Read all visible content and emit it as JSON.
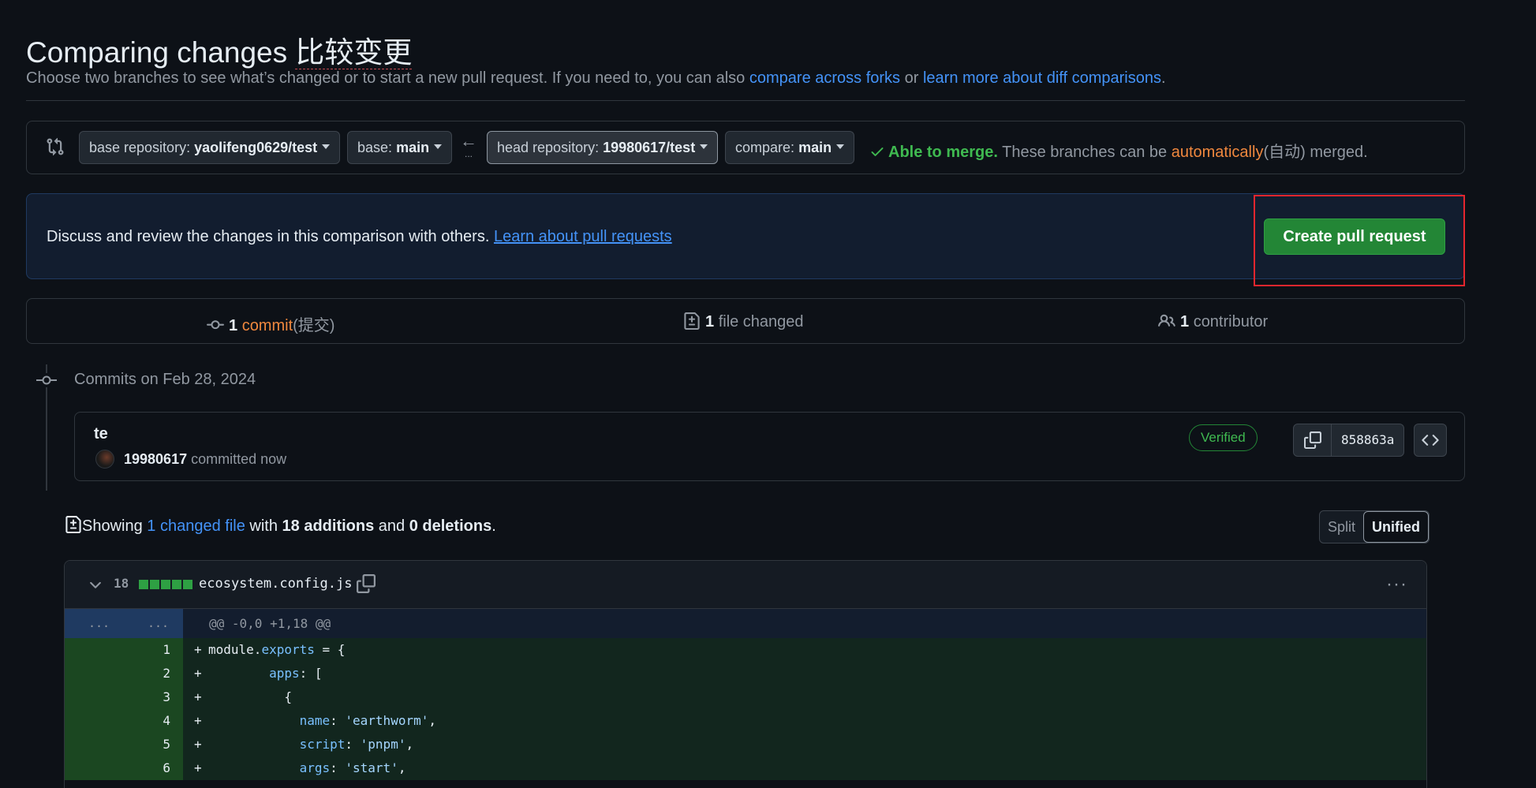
{
  "header": {
    "title": "Comparing changes",
    "title_cn": "比较变更",
    "subtitle_prefix": "Choose two branches to see what’s changed or to start a new pull request. If you need to, you can also",
    "link_forks": "compare across forks",
    "subtitle_or": "or",
    "link_diff": "learn more about diff comparisons",
    "subtitle_end": "."
  },
  "range": {
    "base_repo_label": "base repository:",
    "base_repo_value": "yaolifeng0629/test",
    "base_label": "base:",
    "base_value": "main",
    "arrow": "←",
    "arrow_dots": "...",
    "head_repo_label": "head repository:",
    "head_repo_value": "19980617/test",
    "compare_label": "compare:",
    "compare_value": "main",
    "merge_status": "Able to merge.",
    "merge_text": "These branches can be",
    "merge_auto": "automatically",
    "merge_auto_cn": "(自动)",
    "merge_end": "merged."
  },
  "banner": {
    "text": "Discuss and review the changes in this comparison with others.",
    "link": "Learn about pull requests",
    "button": "Create pull request"
  },
  "summary": {
    "commits_count": "1",
    "commits_label": "commit",
    "commits_cn": "(提交)",
    "files_count": "1",
    "files_label": "file changed",
    "contrib_count": "1",
    "contrib_label": "contributor"
  },
  "commits": {
    "date_heading": "Commits on Feb 28, 2024",
    "items": [
      {
        "title": "te",
        "author": "19980617",
        "meta": "committed now",
        "badge": "Verified",
        "sha": "858863a"
      }
    ]
  },
  "diff_toolbar": {
    "showing": "Showing",
    "changed_file": "1 changed file",
    "with": "with",
    "additions": "18 additions",
    "and": "and",
    "deletions": "0 deletions",
    "period": ".",
    "split": "Split",
    "unified": "Unified"
  },
  "file": {
    "count": "18",
    "name": "ecosystem.config.js",
    "kebab": "···",
    "hunk_left": "...",
    "hunk_right": "...",
    "hunk": "@@ -0,0 +1,18 @@",
    "lines": [
      {
        "n": "1",
        "indent": "",
        "parts": [
          [
            "",
            "module."
          ],
          [
            "prop",
            "exports"
          ],
          [
            "",
            " = {"
          ]
        ]
      },
      {
        "n": "2",
        "indent": "        ",
        "parts": [
          [
            "prop",
            "apps"
          ],
          [
            "",
            ": ["
          ]
        ]
      },
      {
        "n": "3",
        "indent": "          ",
        "parts": [
          [
            "",
            "{"
          ]
        ]
      },
      {
        "n": "4",
        "indent": "            ",
        "parts": [
          [
            "prop",
            "name"
          ],
          [
            "",
            ": "
          ],
          [
            "str",
            "'earthworm'"
          ],
          [
            "",
            ","
          ]
        ]
      },
      {
        "n": "5",
        "indent": "            ",
        "parts": [
          [
            "prop",
            "script"
          ],
          [
            "",
            ": "
          ],
          [
            "str",
            "'pnpm'"
          ],
          [
            "",
            ","
          ]
        ]
      },
      {
        "n": "6",
        "indent": "            ",
        "parts": [
          [
            "prop",
            "args"
          ],
          [
            "",
            ": "
          ],
          [
            "str",
            "'start'"
          ],
          [
            "",
            ","
          ]
        ]
      }
    ]
  },
  "colors": {
    "background": "#0d1117",
    "accent_link": "#4493f8",
    "success": "#3fb950",
    "button_green": "#238636",
    "highlight_red": "#e5262e",
    "orange": "#f0883e"
  }
}
